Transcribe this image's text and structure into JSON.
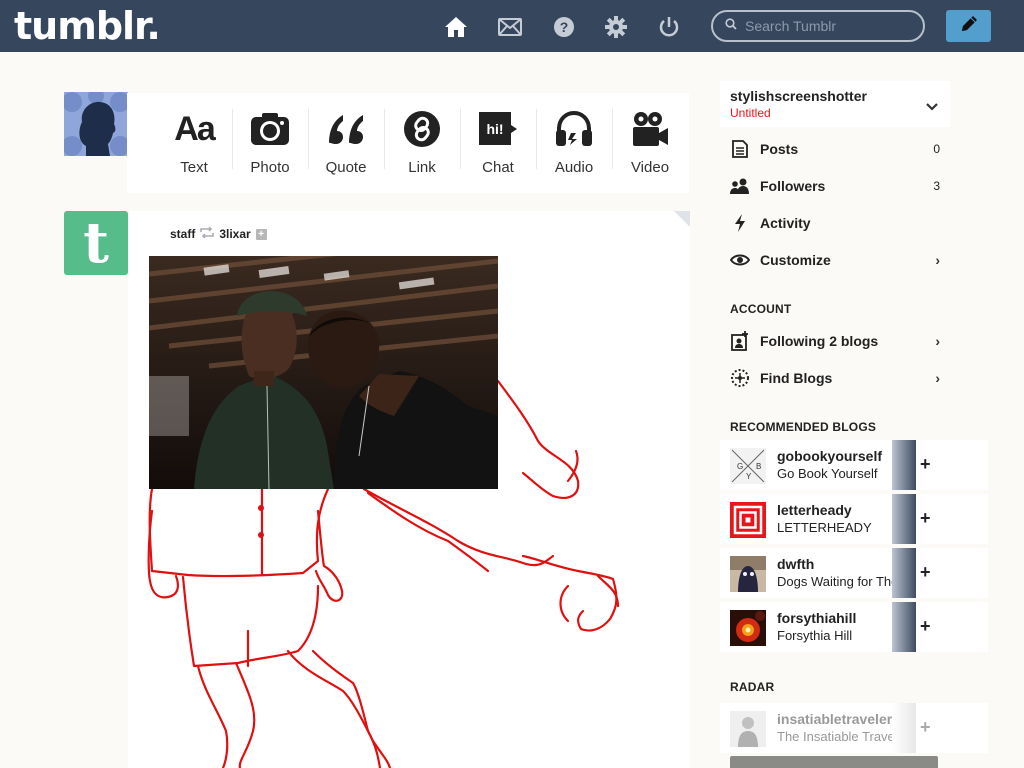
{
  "header": {
    "logo": "tumblr.",
    "nav": [
      "home-icon",
      "inbox-icon",
      "help-icon",
      "settings-icon",
      "logout-icon"
    ],
    "search_placeholder": "Search Tumblr",
    "compose_icon": "pencil-icon",
    "colors": {
      "bar": "#36465d",
      "compose": "#529ecc"
    }
  },
  "composer": {
    "types": [
      {
        "label": "Text",
        "icon": "text-icon"
      },
      {
        "label": "Photo",
        "icon": "camera-icon"
      },
      {
        "label": "Quote",
        "icon": "quote-icon"
      },
      {
        "label": "Link",
        "icon": "link-icon"
      },
      {
        "label": "Chat",
        "icon": "chat-icon"
      },
      {
        "label": "Audio",
        "icon": "headphones-icon"
      },
      {
        "label": "Video",
        "icon": "video-camera-icon"
      }
    ],
    "chat_glyph": "hi!"
  },
  "post": {
    "author": "staff",
    "reblogged_from": "3lixar",
    "avatar_letter": "t"
  },
  "sidebar": {
    "blog_name": "stylishscreenshotter",
    "blog_title": "Untitled",
    "menu": [
      {
        "label": "Posts",
        "count": "0",
        "icon": "posts-icon"
      },
      {
        "label": "Followers",
        "count": "3",
        "icon": "followers-icon"
      },
      {
        "label": "Activity",
        "icon": "activity-icon"
      },
      {
        "label": "Customize",
        "arrow": "›",
        "icon": "eye-icon"
      }
    ],
    "account_title": "ACCOUNT",
    "account": [
      {
        "label": "Following 2 blogs",
        "arrow": "›",
        "icon": "following-icon"
      },
      {
        "label": "Find Blogs",
        "arrow": "›",
        "icon": "find-blogs-icon"
      }
    ],
    "recommended_title": "RECOMMENDED BLOGS",
    "recommended": [
      {
        "name": "gobookyourself",
        "title": "Go Book Yourself",
        "action": "+"
      },
      {
        "name": "letterheady",
        "title": "LETTERHEADY",
        "action": "+"
      },
      {
        "name": "dwfth",
        "title": "Dogs Waiting for Their",
        "action": "+"
      },
      {
        "name": "forsythiahill",
        "title": "Forsythia Hill",
        "action": "+"
      }
    ],
    "radar_title": "RADAR",
    "radar": {
      "name": "insatiabletraveler",
      "title": "The Insatiable Traveler",
      "action": "+"
    },
    "accent_color": "#e8181a"
  }
}
